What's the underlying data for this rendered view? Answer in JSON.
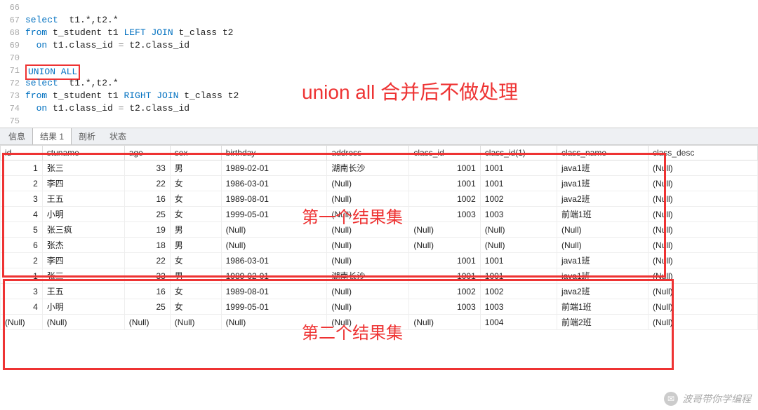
{
  "code": {
    "lines": [
      {
        "n": 66,
        "segments": []
      },
      {
        "n": 67,
        "segments": [
          {
            "t": "select",
            "c": "kw-blue"
          },
          {
            "t": "  t1.*,t2.*",
            "c": "plain"
          }
        ]
      },
      {
        "n": 68,
        "segments": [
          {
            "t": "from",
            "c": "kw-blue"
          },
          {
            "t": " t_student t1 ",
            "c": "plain"
          },
          {
            "t": "LEFT JOIN",
            "c": "kw-blue"
          },
          {
            "t": " t_class t2",
            "c": "plain"
          }
        ]
      },
      {
        "n": 69,
        "segments": [
          {
            "t": "  ",
            "c": "plain"
          },
          {
            "t": "on",
            "c": "kw-blue"
          },
          {
            "t": " t1.class_id ",
            "c": "plain"
          },
          {
            "t": "=",
            "c": "kw-grey"
          },
          {
            "t": " t2.class_id",
            "c": "plain"
          }
        ]
      },
      {
        "n": 70,
        "segments": []
      },
      {
        "n": 71,
        "segments": [
          {
            "t": "UNION ALL",
            "c": "kw-blue",
            "box": true
          }
        ]
      },
      {
        "n": 72,
        "segments": [
          {
            "t": "select",
            "c": "kw-blue"
          },
          {
            "t": "  t1.*,t2.*",
            "c": "plain"
          }
        ]
      },
      {
        "n": 73,
        "segments": [
          {
            "t": "from",
            "c": "kw-blue"
          },
          {
            "t": " t_student t1 ",
            "c": "plain"
          },
          {
            "t": "RIGHT JOIN",
            "c": "kw-blue"
          },
          {
            "t": " t_class t2",
            "c": "plain"
          }
        ]
      },
      {
        "n": 74,
        "segments": [
          {
            "t": "  ",
            "c": "plain"
          },
          {
            "t": "on",
            "c": "kw-blue"
          },
          {
            "t": " t1.class_id ",
            "c": "plain"
          },
          {
            "t": "=",
            "c": "kw-grey"
          },
          {
            "t": " t2.class_id",
            "c": "plain"
          }
        ]
      },
      {
        "n": 75,
        "segments": []
      }
    ]
  },
  "tabs": [
    {
      "label": "信息",
      "active": false
    },
    {
      "label": "结果 1",
      "active": true
    },
    {
      "label": "剖析",
      "active": false
    },
    {
      "label": "状态",
      "active": false
    }
  ],
  "columns": [
    "id",
    "stuname",
    "age",
    "sex",
    "birthday",
    "address",
    "class_id",
    "class_id(1)",
    "class_name",
    "class_desc"
  ],
  "rows": [
    {
      "id": "1",
      "stuname": "张三",
      "age": "33",
      "sex": "男",
      "birthday": "1989-02-01",
      "address": "湖南长沙",
      "class_id": "1001",
      "class_id1": "1001",
      "class_name": "java1班",
      "class_desc": "(Null)"
    },
    {
      "id": "2",
      "stuname": "李四",
      "age": "22",
      "sex": "女",
      "birthday": "1986-03-01",
      "address": "(Null)",
      "class_id": "1001",
      "class_id1": "1001",
      "class_name": "java1班",
      "class_desc": "(Null)"
    },
    {
      "id": "3",
      "stuname": "王五",
      "age": "16",
      "sex": "女",
      "birthday": "1989-08-01",
      "address": "(Null)",
      "class_id": "1002",
      "class_id1": "1002",
      "class_name": "java2班",
      "class_desc": "(Null)"
    },
    {
      "id": "4",
      "stuname": "小明",
      "age": "25",
      "sex": "女",
      "birthday": "1999-05-01",
      "address": "(Null)",
      "class_id": "1003",
      "class_id1": "1003",
      "class_name": "前端1班",
      "class_desc": "(Null)"
    },
    {
      "id": "5",
      "stuname": "张三疯",
      "age": "19",
      "sex": "男",
      "birthday": "(Null)",
      "address": "(Null)",
      "class_id": "(Null)",
      "class_id1": "(Null)",
      "class_name": "(Null)",
      "class_desc": "(Null)"
    },
    {
      "id": "6",
      "stuname": "张杰",
      "age": "18",
      "sex": "男",
      "birthday": "(Null)",
      "address": "(Null)",
      "class_id": "(Null)",
      "class_id1": "(Null)",
      "class_name": "(Null)",
      "class_desc": "(Null)"
    },
    {
      "id": "2",
      "stuname": "李四",
      "age": "22",
      "sex": "女",
      "birthday": "1986-03-01",
      "address": "(Null)",
      "class_id": "1001",
      "class_id1": "1001",
      "class_name": "java1班",
      "class_desc": "(Null)"
    },
    {
      "id": "1",
      "stuname": "张三",
      "age": "33",
      "sex": "男",
      "birthday": "1989-02-01",
      "address": "湖南长沙",
      "class_id": "1001",
      "class_id1": "1001",
      "class_name": "java1班",
      "class_desc": "(Null)"
    },
    {
      "id": "3",
      "stuname": "王五",
      "age": "16",
      "sex": "女",
      "birthday": "1989-08-01",
      "address": "(Null)",
      "class_id": "1002",
      "class_id1": "1002",
      "class_name": "java2班",
      "class_desc": "(Null)"
    },
    {
      "id": "4",
      "stuname": "小明",
      "age": "25",
      "sex": "女",
      "birthday": "1999-05-01",
      "address": "(Null)",
      "class_id": "1003",
      "class_id1": "1003",
      "class_name": "前端1班",
      "class_desc": "(Null)"
    },
    {
      "id": "(Null)",
      "stuname": "(Null)",
      "age": "(Null)",
      "sex": "(Null)",
      "birthday": "(Null)",
      "address": "(Null)",
      "class_id": "(Null)",
      "class_id1": "1004",
      "class_name": "前端2班",
      "class_desc": "(Null)"
    }
  ],
  "annotations": {
    "main": "union all 合并后不做处理",
    "set1": "第一个结果集",
    "set2": "第二个结果集"
  },
  "watermark": "波哥带你学编程"
}
